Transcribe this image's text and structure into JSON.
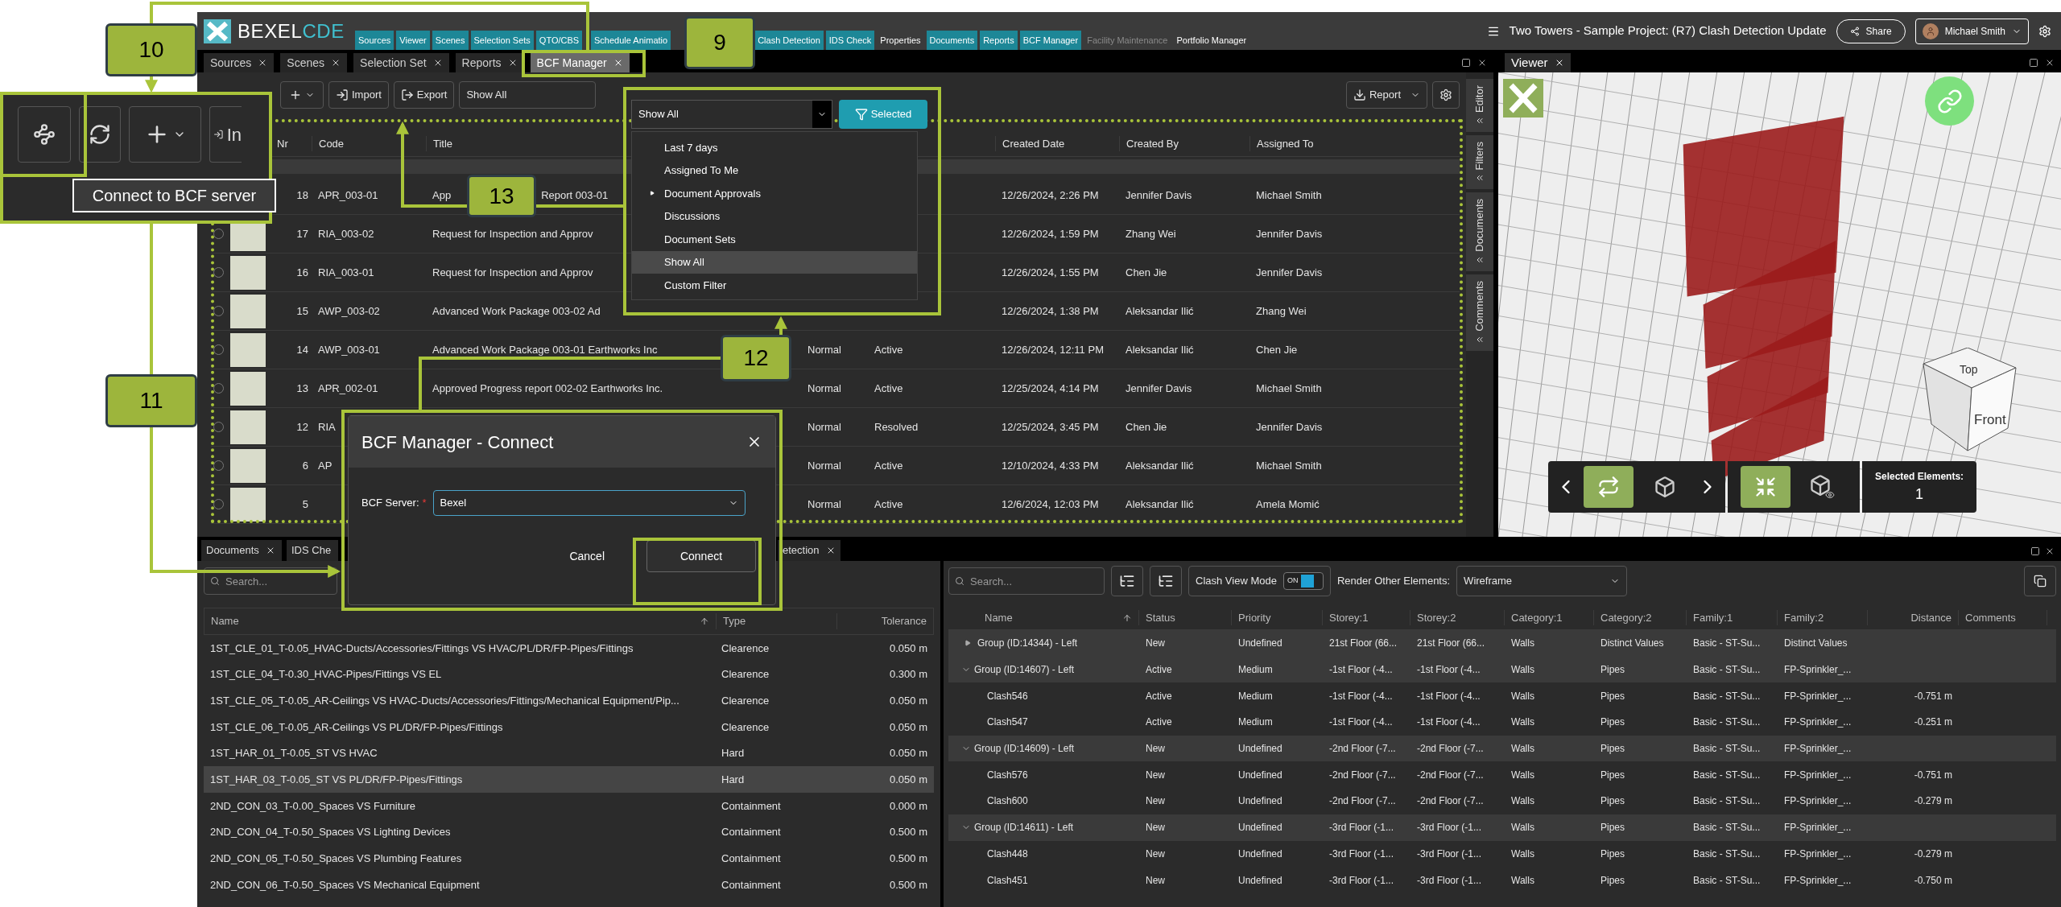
{
  "header": {
    "logo": "BEXEL",
    "logo_accent": "CDE",
    "nav_groups": [
      [
        {
          "label": "Sources",
          "kind": "module"
        },
        {
          "label": "Viewer",
          "kind": "module"
        },
        {
          "label": "Scenes",
          "kind": "module"
        },
        {
          "label": "Selection Sets",
          "kind": "module"
        },
        {
          "label": "QTO/CBS",
          "kind": "module"
        }
      ],
      [
        {
          "label": "Schedule Animatio",
          "kind": "module"
        }
      ],
      [
        {
          "label": "Clash Detection",
          "kind": "module"
        },
        {
          "label": "IDS Check",
          "kind": "module"
        },
        {
          "label": "Properties",
          "kind": "plain"
        },
        {
          "label": "Documents",
          "kind": "module"
        },
        {
          "label": "Reports",
          "kind": "module"
        },
        {
          "label": "BCF Manager",
          "kind": "module"
        },
        {
          "label": "Facility Maintenance",
          "kind": "dim"
        },
        {
          "label": "Portfolio Manager",
          "kind": "plain"
        }
      ]
    ],
    "project_title": "Two Towers - Sample Project: (R7) Clash Detection Update",
    "share": "Share",
    "user": "Michael Smith"
  },
  "panel_tabs": [
    {
      "label": "Sources",
      "selected": false
    },
    {
      "label": "Scenes",
      "selected": false
    },
    {
      "label": "Selection Set",
      "selected": false
    },
    {
      "label": "Reports",
      "selected": false
    },
    {
      "label": "BCF Manager",
      "selected": true
    }
  ],
  "toolbar": {
    "import": "Import",
    "export": "Export",
    "filter": "Show All",
    "report": "Report"
  },
  "bcf_table": {
    "columns": [
      "Nr",
      "Code",
      "Title",
      "Created Date",
      "Created By",
      "Assigned To"
    ],
    "rows": [
      {
        "nr": "18",
        "code": "APR_003-01",
        "title": "App",
        "title_tail": "Report 003-01",
        "created": "12/26/2024, 2:26 PM",
        "by": "Jennifer Davis",
        "assigned": "Michael Smith"
      },
      {
        "checked": false,
        "nr": "17",
        "code": "RIA_003-02",
        "title": "Request for Inspection and Approv",
        "created": "12/26/2024, 1:59 PM",
        "by": "Zhang Wei",
        "assigned": "Jennifer Davis"
      },
      {
        "checked": false,
        "nr": "16",
        "code": "RIA_003-01",
        "title": "Request for Inspection and Approv",
        "created": "12/26/2024, 1:55 PM",
        "by": "Chen Jie",
        "assigned": "Jennifer Davis"
      },
      {
        "checked": false,
        "nr": "15",
        "code": "AWP_003-02",
        "title": "Advanced Work Package 003-02 Ad",
        "created": "12/26/2024, 1:38 PM",
        "by": "Aleksandar Ilić",
        "assigned": "Zhang Wei"
      },
      {
        "checked": false,
        "nr": "14",
        "code": "AWP_003-01",
        "title": "Advanced Work Package 003-01 Earthworks Inc",
        "priority": "Normal",
        "status": "Active",
        "created": "12/26/2024, 12:11 PM",
        "by": "Aleksandar Ilić",
        "assigned": "Chen Jie"
      },
      {
        "checked": false,
        "nr": "13",
        "code": "APR_002-01",
        "title": "Approved Progress report 002-02 Earthworks Inc.",
        "priority": "Normal",
        "status": "Active",
        "created": "12/25/2024, 4:14 PM",
        "by": "Jennifer Davis",
        "assigned": "Michael Smith"
      },
      {
        "checked": false,
        "nr": "12",
        "code": "RIA",
        "priority": "Normal",
        "status": "Resolved",
        "created": "12/25/2024, 3:45 PM",
        "by": "Chen Jie",
        "assigned": "Jennifer Davis"
      },
      {
        "checked": false,
        "nr": "6",
        "code": "AP",
        "priority": "Normal",
        "status": "Active",
        "created": "12/10/2024, 4:33 PM",
        "by": "Aleksandar Ilić",
        "assigned": "Michael Smith"
      },
      {
        "checked": false,
        "nr": "5",
        "priority": "Normal",
        "status": "Active",
        "created": "12/6/2024, 12:03 PM",
        "by": "Aleksandar Ilić",
        "assigned": "Amela Momić"
      }
    ]
  },
  "side_tabs": [
    "Editor",
    "Filters",
    "Documents",
    "Comments"
  ],
  "viewer": {
    "tab": "Viewer",
    "cube_top": "Top",
    "cube_front": "Front",
    "selected_label": "Selected Elements:",
    "selected_count": "1",
    "tool_groups": [
      [
        {
          "kind": "swap",
          "active": true
        },
        {
          "kind": "cube",
          "active": false
        }
      ],
      [
        {
          "kind": "collapse",
          "active": true
        },
        {
          "kind": "cube-eye",
          "active": false
        }
      ]
    ]
  },
  "bottom_tabs": [
    "Documents",
    "IDS Che",
    "etection"
  ],
  "rules_panel": {
    "search_placeholder": "Search...",
    "columns": [
      "Name",
      "Type",
      "Tolerance"
    ],
    "rows": [
      {
        "name": "1ST_CLE_01_T-0.05_HVAC-Ducts/Accessories/Fittings VS HVAC/PL/DR/FP-Pipes/Fittings",
        "type": "Clearence",
        "tolerance": "0.050 m",
        "selected": false
      },
      {
        "name": "1ST_CLE_04_T-0.30_HVAC-Pipes/Fittings VS EL",
        "type": "Clearence",
        "tolerance": "0.300 m",
        "selected": false
      },
      {
        "name": "1ST_CLE_05_T-0.05_AR-Ceilings VS HVAC-Ducts/Accessories/Fittings/Mechanical Equipment/Pip...",
        "type": "Clearence",
        "tolerance": "0.050 m",
        "selected": false
      },
      {
        "name": "1ST_CLE_06_T-0.05_AR-Ceilings VS PL/DR/FP-Pipes/Fittings",
        "type": "Clearence",
        "tolerance": "0.050 m",
        "selected": false
      },
      {
        "name": "1ST_HAR_01_T-0.05_ST VS HVAC",
        "type": "Hard",
        "tolerance": "0.050 m",
        "selected": false
      },
      {
        "name": "1ST_HAR_03_T-0.05_ST VS PL/DR/FP-Pipes/Fittings",
        "type": "Hard",
        "tolerance": "0.050 m",
        "selected": true
      },
      {
        "name": "2ND_CON_03_T-0.00_Spaces VS Furniture",
        "type": "Containment",
        "tolerance": "0.000 m",
        "selected": false
      },
      {
        "name": "2ND_CON_04_T-0.50_Spaces VS Lighting Devices",
        "type": "Containment",
        "tolerance": "0.500 m",
        "selected": false
      },
      {
        "name": "2ND_CON_05_T-0.50_Spaces VS Plumbing Features",
        "type": "Containment",
        "tolerance": "0.500 m",
        "selected": false
      },
      {
        "name": "2ND_CON_06_T-0.50_Spaces VS Mechanical Equipment",
        "type": "Containment",
        "tolerance": "0.500 m",
        "selected": false
      }
    ]
  },
  "clash_panel": {
    "search_placeholder": "Search...",
    "view_mode_label": "Clash View Mode",
    "toggle": {
      "text": "ON",
      "on": true
    },
    "render_label": "Render Other Elements:",
    "render_value": "Wireframe",
    "columns": [
      "Name",
      "Status",
      "Priority",
      "Storey:1",
      "Storey:2",
      "Category:1",
      "Category:2",
      "Family:1",
      "Family:2",
      "Distance",
      "Comments"
    ],
    "rows": [
      {
        "kind": "group",
        "expanded": false,
        "name": "Group (ID:14344) - Left",
        "status": "New",
        "priority": "Undefined",
        "storey1": "21st Floor (66...",
        "storey2": "21st Floor (66...",
        "cat1": "Walls",
        "cat2": "Distinct Values",
        "fam1": "Basic - ST-Su...",
        "fam2": "Distinct Values"
      },
      {
        "kind": "group",
        "expanded": true,
        "name": "Group (ID:14607) - Left",
        "status": "Active",
        "priority": "Medium",
        "storey1": "-1st Floor (-4...",
        "storey2": "-1st Floor (-4...",
        "cat1": "Walls",
        "cat2": "Pipes",
        "fam1": "Basic - ST-Su...",
        "fam2": "FP-Sprinkler_...",
        "children": [
          {
            "kind": "clash",
            "name": "Clash546",
            "status": "Active",
            "priority": "Medium",
            "storey1": "-1st Floor (-4...",
            "storey2": "-1st Floor (-4...",
            "cat1": "Walls",
            "cat2": "Pipes",
            "fam1": "Basic - ST-Su...",
            "fam2": "FP-Sprinkler_...",
            "distance": "-0.751 m"
          },
          {
            "kind": "clash",
            "name": "Clash547",
            "status": "Active",
            "priority": "Medium",
            "storey1": "-1st Floor (-4...",
            "storey2": "-1st Floor (-4...",
            "cat1": "Walls",
            "cat2": "Pipes",
            "fam1": "Basic - ST-Su...",
            "fam2": "FP-Sprinkler_...",
            "distance": "-0.251 m"
          }
        ]
      },
      {
        "kind": "group",
        "expanded": true,
        "name": "Group (ID:14609) - Left",
        "status": "New",
        "priority": "Undefined",
        "storey1": "-2nd Floor (-7...",
        "storey2": "-2nd Floor (-7...",
        "cat1": "Walls",
        "cat2": "Pipes",
        "fam1": "Basic - ST-Su...",
        "fam2": "FP-Sprinkler_...",
        "children": [
          {
            "kind": "clash",
            "name": "Clash576",
            "status": "New",
            "priority": "Undefined",
            "storey1": "-2nd Floor (-7...",
            "storey2": "-2nd Floor (-7...",
            "cat1": "Walls",
            "cat2": "Pipes",
            "fam1": "Basic - ST-Su...",
            "fam2": "FP-Sprinkler_...",
            "distance": "-0.751 m"
          },
          {
            "kind": "clash",
            "name": "Clash600",
            "status": "New",
            "priority": "Undefined",
            "storey1": "-2nd Floor (-7...",
            "storey2": "-2nd Floor (-7...",
            "cat1": "Walls",
            "cat2": "Pipes",
            "fam1": "Basic - ST-Su...",
            "fam2": "FP-Sprinkler_...",
            "distance": "-0.279 m"
          }
        ]
      },
      {
        "kind": "group",
        "expanded": true,
        "name": "Group (ID:14611) - Left",
        "status": "New",
        "priority": "Undefined",
        "storey1": "-3rd Floor (-1...",
        "storey2": "-3rd Floor (-1...",
        "cat1": "Walls",
        "cat2": "Pipes",
        "fam1": "Basic - ST-Su...",
        "fam2": "FP-Sprinkler_...",
        "children": [
          {
            "kind": "clash",
            "name": "Clash448",
            "status": "New",
            "priority": "Undefined",
            "storey1": "-3rd Floor (-1...",
            "storey2": "-3rd Floor (-1...",
            "cat1": "Walls",
            "cat2": "Pipes",
            "fam1": "Basic - ST-Su...",
            "fam2": "FP-Sprinkler_...",
            "distance": "-0.279 m"
          },
          {
            "kind": "clash",
            "name": "Clash451",
            "status": "New",
            "priority": "Undefined",
            "storey1": "-3rd Floor (-1...",
            "storey2": "-3rd Floor (-1...",
            "cat1": "Walls",
            "cat2": "Pipes",
            "fam1": "Basic - ST-Su...",
            "fam2": "FP-Sprinkler_...",
            "distance": "-0.750 m"
          }
        ]
      }
    ]
  },
  "filter_dropdown": {
    "value": "Show All",
    "button": "Selected",
    "items": [
      {
        "label": "Last 7 days",
        "selected": false,
        "submenu": false
      },
      {
        "label": "Assigned To Me",
        "selected": false,
        "submenu": false
      },
      {
        "label": "Document Approvals",
        "selected": false,
        "submenu": true
      },
      {
        "label": "Discussions",
        "selected": false,
        "submenu": false
      },
      {
        "label": "Document Sets",
        "selected": false,
        "submenu": false
      },
      {
        "label": "Show All",
        "selected": true,
        "submenu": false
      },
      {
        "label": "Custom Filter",
        "selected": false,
        "submenu": false
      }
    ]
  },
  "dialog": {
    "title": "BCF Manager - Connect",
    "field_label": "BCF Server:",
    "required_mark": "*",
    "value": "Bexel",
    "cancel": "Cancel",
    "connect": "Connect"
  },
  "inset": {
    "import_partial": "In",
    "tooltip": "Connect to BCF server"
  },
  "callouts": [
    "10",
    "9",
    "13",
    "12",
    "11"
  ]
}
